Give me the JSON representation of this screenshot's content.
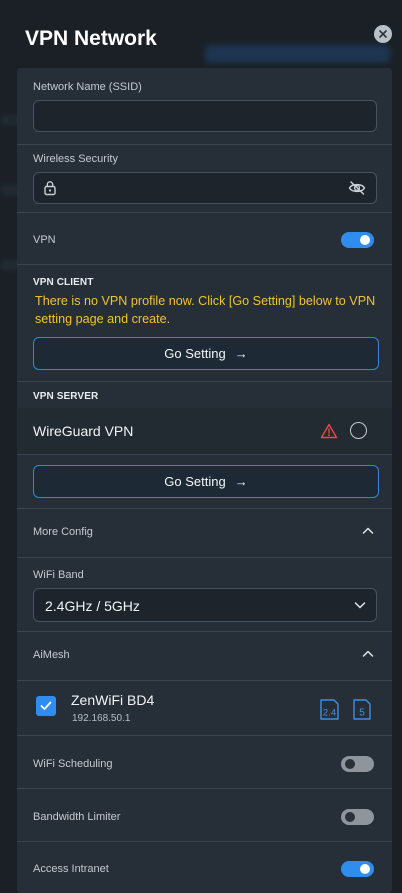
{
  "header": {
    "title": "VPN Network"
  },
  "form": {
    "ssid": {
      "label": "Network Name (SSID)",
      "value": "",
      "placeholder": ""
    },
    "security": {
      "label": "Wireless Security"
    },
    "vpn": {
      "label": "VPN",
      "enabled": true
    }
  },
  "vpn_client": {
    "heading": "VPN CLIENT",
    "notice": "There is no VPN profile now. Click [Go Setting] below to VPN setting page and create.",
    "button_label": "Go Setting"
  },
  "vpn_server": {
    "heading": "VPN SERVER",
    "item_name": "WireGuard VPN",
    "button_label": "Go Setting"
  },
  "more_config": {
    "title": "More Config",
    "wifi_band": {
      "label": "WiFi Band",
      "value": "2.4GHz / 5GHz"
    }
  },
  "aimesh": {
    "title": "AiMesh",
    "node": {
      "name": "ZenWiFi BD4",
      "ip": "192.168.50.1",
      "bands": [
        "2.4",
        "5"
      ]
    }
  },
  "wifi_scheduling": {
    "label": "WiFi Scheduling",
    "enabled": false
  },
  "bandwidth_limiter": {
    "label": "Bandwidth Limiter",
    "enabled": false
  },
  "access_intranet": {
    "label": "Access Intranet",
    "enabled": true
  },
  "colors": {
    "accent": "#2f8df0",
    "warning": "#f2c230",
    "alert": "#e5484d"
  },
  "icons": [
    "close-icon",
    "lock-icon",
    "eye-off-icon",
    "arrow-right-icon",
    "warning-icon",
    "chevron-up-icon",
    "chevron-down-icon",
    "check-icon"
  ]
}
